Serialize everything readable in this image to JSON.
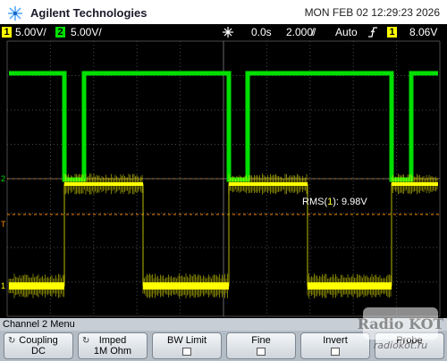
{
  "header": {
    "brand": "Agilent Technologies",
    "datetime": "MON FEB 02 12:29:23 2026"
  },
  "status_bar": {
    "ch1_num": "1",
    "ch1_scale": "5.00V/",
    "ch2_num": "2",
    "ch2_scale": "5.00V/",
    "trig_pos": "0.0s",
    "timebase": "2.000̸/",
    "trig_mode": "Auto",
    "trig_source": "1",
    "trig_level": "8.06V"
  },
  "measurement": {
    "prefix": "RMS(",
    "channel": "1",
    "suffix": "): 9.98V"
  },
  "menu": {
    "title": "Channel 2  Menu",
    "softkeys": [
      {
        "line1": "Coupling",
        "line2": "DC"
      },
      {
        "line1": "Imped",
        "line2": "1M Ohm"
      },
      {
        "line1": "BW Limit"
      },
      {
        "line1": "Fine"
      },
      {
        "line1": "Invert"
      },
      {
        "line1": "Probe"
      }
    ]
  },
  "markers": {
    "ch1": "1",
    "ch2": "2",
    "trig": "T"
  },
  "watermark": {
    "top": "Radio KOT",
    "bottom": "radiokot.ru"
  },
  "colors": {
    "ch1": "#ffff00",
    "ch2": "#00e000",
    "ch1_dim": "#b8b800",
    "trigger": "#ff8c00",
    "grid": "#4a4a4a",
    "header_bg": "#ffffff",
    "menu_bg": "#b4bcc5"
  }
}
